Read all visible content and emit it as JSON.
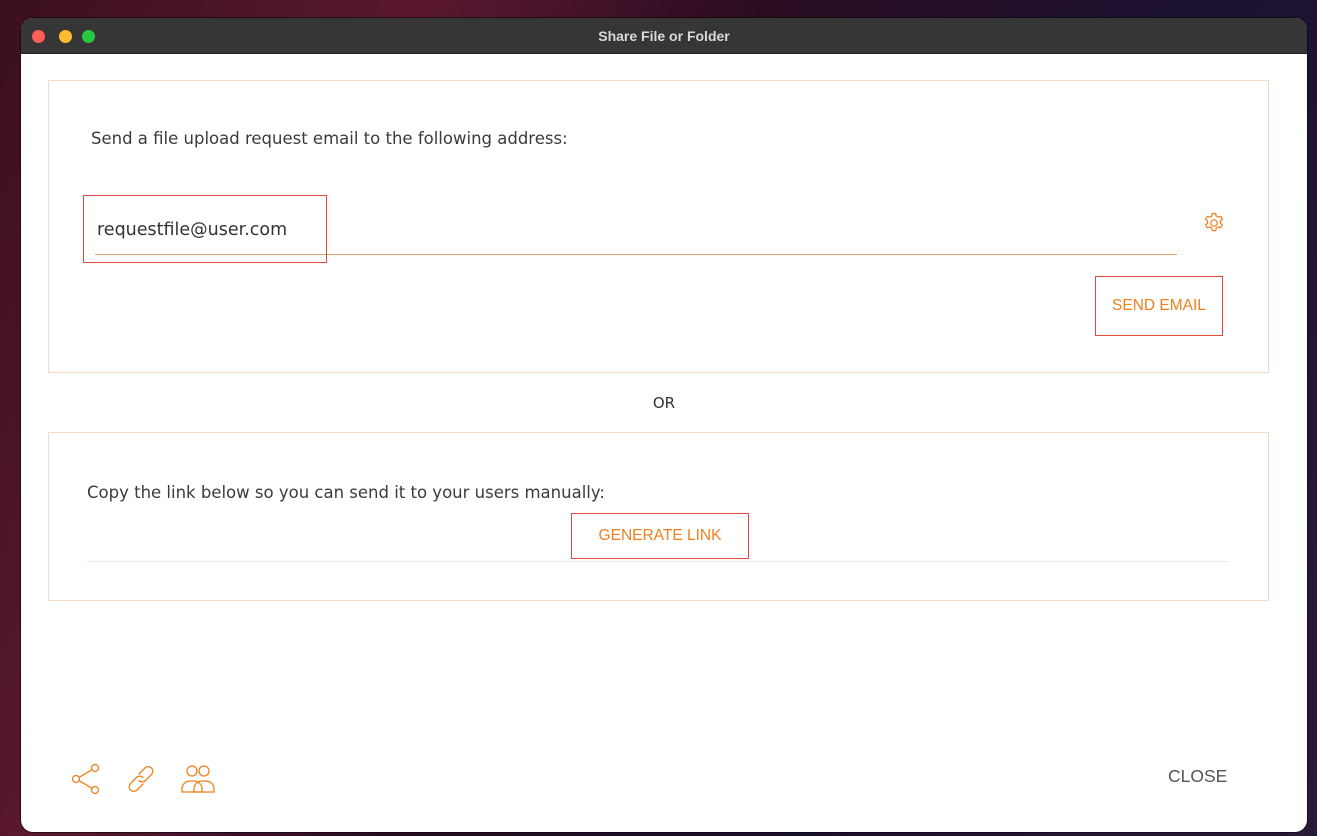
{
  "window": {
    "title": "Share File or Folder"
  },
  "email_section": {
    "prompt": "Send a file upload request email to the following address:",
    "email_value": "requestfile@user.com",
    "send_button": "SEND EMAIL",
    "settings_icon": "gear-icon"
  },
  "or_label": "OR",
  "link_section": {
    "prompt": "Copy the link below so you can send it to your users manually:",
    "generate_button": "GENERATE LINK"
  },
  "footer": {
    "icons": [
      "share-icon",
      "link-icon",
      "users-icon"
    ],
    "close_button": "CLOSE"
  },
  "colors": {
    "accent": "#f07f1c",
    "panel_border": "#f6d9c4",
    "highlight": "#e04a3c",
    "titlebar": "#363636"
  }
}
